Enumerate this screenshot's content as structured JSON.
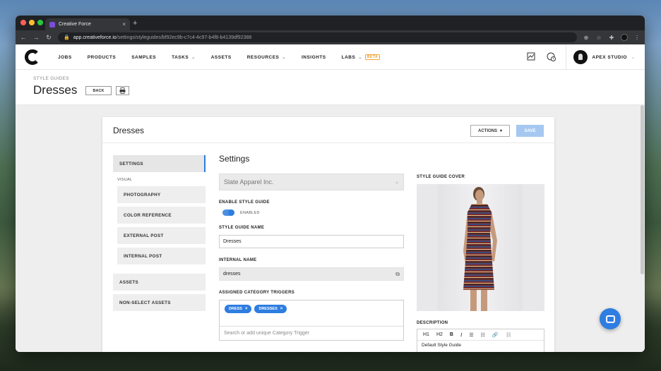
{
  "browser": {
    "tab_title": "Creative Force",
    "tab_close": "×",
    "new_tab": "+",
    "url_host": "app.creativeforce.io",
    "url_path": "/settings/styleguides/bf92ec9b-c7c4-4c97-b4f8-b4139df92388"
  },
  "nav": {
    "items": [
      "JOBS",
      "PRODUCTS",
      "SAMPLES",
      "TASKS",
      "ASSETS",
      "RESOURCES",
      "INSIGHTS",
      "LABS"
    ],
    "beta": "BETA",
    "studio": "APEX STUDIO"
  },
  "page": {
    "breadcrumb": "STYLE GUIDES",
    "title": "Dresses",
    "back": "BACK"
  },
  "card": {
    "title": "Dresses",
    "actions": "ACTIONS",
    "save": "SAVE"
  },
  "sidebar": {
    "items": [
      "SETTINGS",
      "PHOTOGRAPHY",
      "COLOR REFERENCE",
      "EXTERNAL POST",
      "INTERNAL POST",
      "ASSETS",
      "NON-SELECT ASSETS"
    ],
    "group_visual": "VISUAL"
  },
  "form": {
    "section_title": "Settings",
    "client": "Slate Apparel Inc.",
    "enable_label": "ENABLE STYLE GUIDE",
    "enabled_text": "ENABLED",
    "name_label": "STYLE GUIDE NAME",
    "name_value": "Dresses",
    "internal_label": "INTERNAL NAME",
    "internal_value": "dresses",
    "triggers_label": "ASSIGNED CATEGORY TRIGGERS",
    "tags": [
      "DRESS",
      "DRESSES"
    ],
    "trigger_placeholder": "Search or add unique Category Trigger"
  },
  "right": {
    "cover_label": "STYLE GUIDE COVER",
    "description_label": "DESCRIPTION",
    "toolbar": [
      "H1",
      "H2",
      "B",
      "I"
    ],
    "description_text": "Default Style Guide"
  },
  "colors": {
    "accent": "#2e7de1",
    "save_disabled": "#a6c8f0"
  }
}
